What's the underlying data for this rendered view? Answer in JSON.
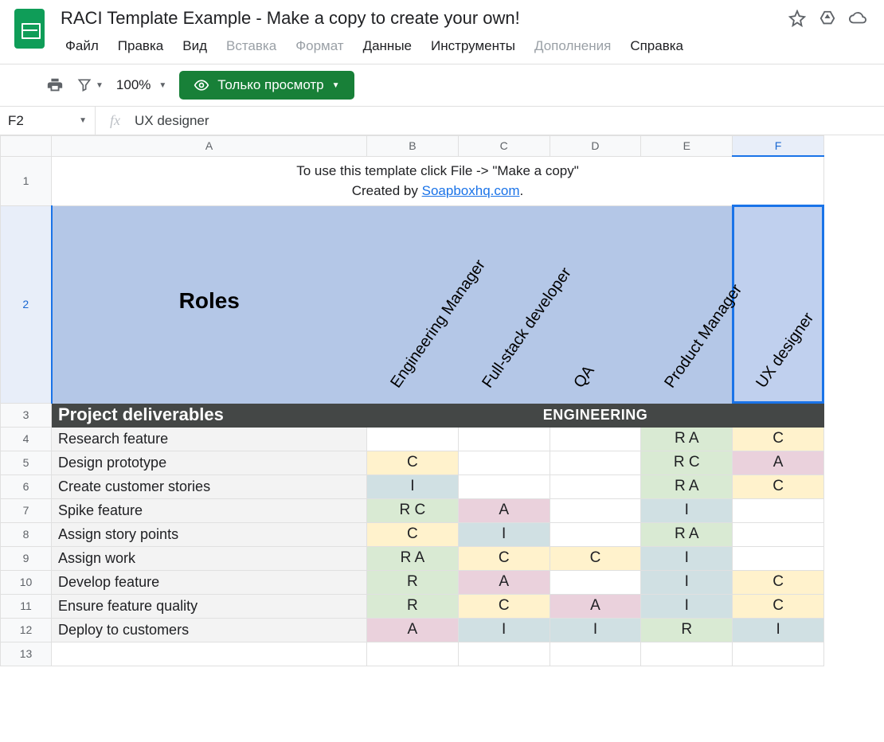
{
  "header": {
    "title": "RACI Template Example - Make a copy to create your own!"
  },
  "menu": {
    "file": "Файл",
    "edit": "Правка",
    "view": "Вид",
    "insert": "Вставка",
    "format": "Формат",
    "data": "Данные",
    "tools": "Инструменты",
    "addons": "Дополнения",
    "help": "Справка"
  },
  "toolbar": {
    "zoom": "100%",
    "view_only": "Только просмотр"
  },
  "formula_bar": {
    "name_box": "F2",
    "fx": "fx",
    "content": "UX designer"
  },
  "columns": [
    "A",
    "B",
    "C",
    "D",
    "E",
    "F"
  ],
  "selected_column": "F",
  "selected_row": "2",
  "row1": {
    "line1": "To use this template click File -> \"Make a copy\"",
    "line2_prefix": "Created by ",
    "link_text": "Soapboxhq.com",
    "period": "."
  },
  "row2": {
    "roles_label": "Roles",
    "r_B": "Engineering Manager",
    "r_C": "Full-stack developer",
    "r_D": "QA",
    "r_E": "Product Manager",
    "r_F": "UX designer"
  },
  "row3": {
    "deliverables": "Project deliverables",
    "engineering": "ENGINEERING"
  },
  "tasks": {
    "t4": "Research feature",
    "t5": "Design prototype",
    "t6": "Create customer stories",
    "t7": "Spike feature",
    "t8": "Assign story points",
    "t9": "Assign work",
    "t10": "Develop feature",
    "t11": "Ensure feature quality",
    "t12": "Deploy to customers"
  },
  "raci": {
    "r4": {
      "B": "",
      "C": "",
      "D": "",
      "E": "R A",
      "F": "C"
    },
    "r5": {
      "B": "C",
      "C": "",
      "D": "",
      "E": "R C",
      "F": "A"
    },
    "r6": {
      "B": "I",
      "C": "",
      "D": "",
      "E": "R A",
      "F": "C"
    },
    "r7": {
      "B": "R C",
      "C": "A",
      "D": "",
      "E": "I",
      "F": ""
    },
    "r8": {
      "B": "C",
      "C": "I",
      "D": "",
      "E": "R A",
      "F": ""
    },
    "r9": {
      "B": "R A",
      "C": "C",
      "D": "C",
      "E": "I",
      "F": ""
    },
    "r10": {
      "B": "R",
      "C": "A",
      "D": "",
      "E": "I",
      "F": "C"
    },
    "r11": {
      "B": "R",
      "C": "C",
      "D": "A",
      "E": "I",
      "F": "C"
    },
    "r12": {
      "B": "A",
      "C": "I",
      "D": "I",
      "E": "R",
      "F": "I"
    }
  },
  "raci_bg": {
    "r4": {
      "B": "",
      "C": "",
      "D": "",
      "E": "green",
      "F": "yellow"
    },
    "r5": {
      "B": "yellow",
      "C": "",
      "D": "",
      "E": "green",
      "F": "pink"
    },
    "r6": {
      "B": "blue",
      "C": "",
      "D": "",
      "E": "green",
      "F": "yellow"
    },
    "r7": {
      "B": "green",
      "C": "pink",
      "D": "",
      "E": "blue",
      "F": ""
    },
    "r8": {
      "B": "yellow",
      "C": "blue",
      "D": "",
      "E": "green",
      "F": ""
    },
    "r9": {
      "B": "green",
      "C": "yellow",
      "D": "yellow",
      "E": "blue",
      "F": ""
    },
    "r10": {
      "B": "green",
      "C": "pink",
      "D": "",
      "E": "blue",
      "F": "yellow"
    },
    "r11": {
      "B": "green",
      "C": "yellow",
      "D": "pink",
      "E": "blue",
      "F": "yellow"
    },
    "r12": {
      "B": "pink",
      "C": "blue",
      "D": "blue",
      "E": "green",
      "F": "blue"
    }
  },
  "chart_data": {
    "type": "table",
    "title": "RACI Matrix — ENGINEERING",
    "columns": [
      "Engineering Manager",
      "Full-stack developer",
      "QA",
      "Product Manager",
      "UX designer"
    ],
    "rows": [
      {
        "task": "Research feature",
        "values": [
          "",
          "",
          "",
          "R A",
          "C"
        ]
      },
      {
        "task": "Design prototype",
        "values": [
          "C",
          "",
          "",
          "R C",
          "A"
        ]
      },
      {
        "task": "Create customer stories",
        "values": [
          "I",
          "",
          "",
          "R A",
          "C"
        ]
      },
      {
        "task": "Spike feature",
        "values": [
          "R C",
          "A",
          "",
          "I",
          ""
        ]
      },
      {
        "task": "Assign story points",
        "values": [
          "C",
          "I",
          "",
          "R A",
          ""
        ]
      },
      {
        "task": "Assign work",
        "values": [
          "R A",
          "C",
          "C",
          "I",
          ""
        ]
      },
      {
        "task": "Develop feature",
        "values": [
          "R",
          "A",
          "",
          "I",
          "C"
        ]
      },
      {
        "task": "Ensure feature quality",
        "values": [
          "R",
          "C",
          "A",
          "I",
          "C"
        ]
      },
      {
        "task": "Deploy to customers",
        "values": [
          "A",
          "I",
          "I",
          "R",
          "I"
        ]
      }
    ]
  }
}
